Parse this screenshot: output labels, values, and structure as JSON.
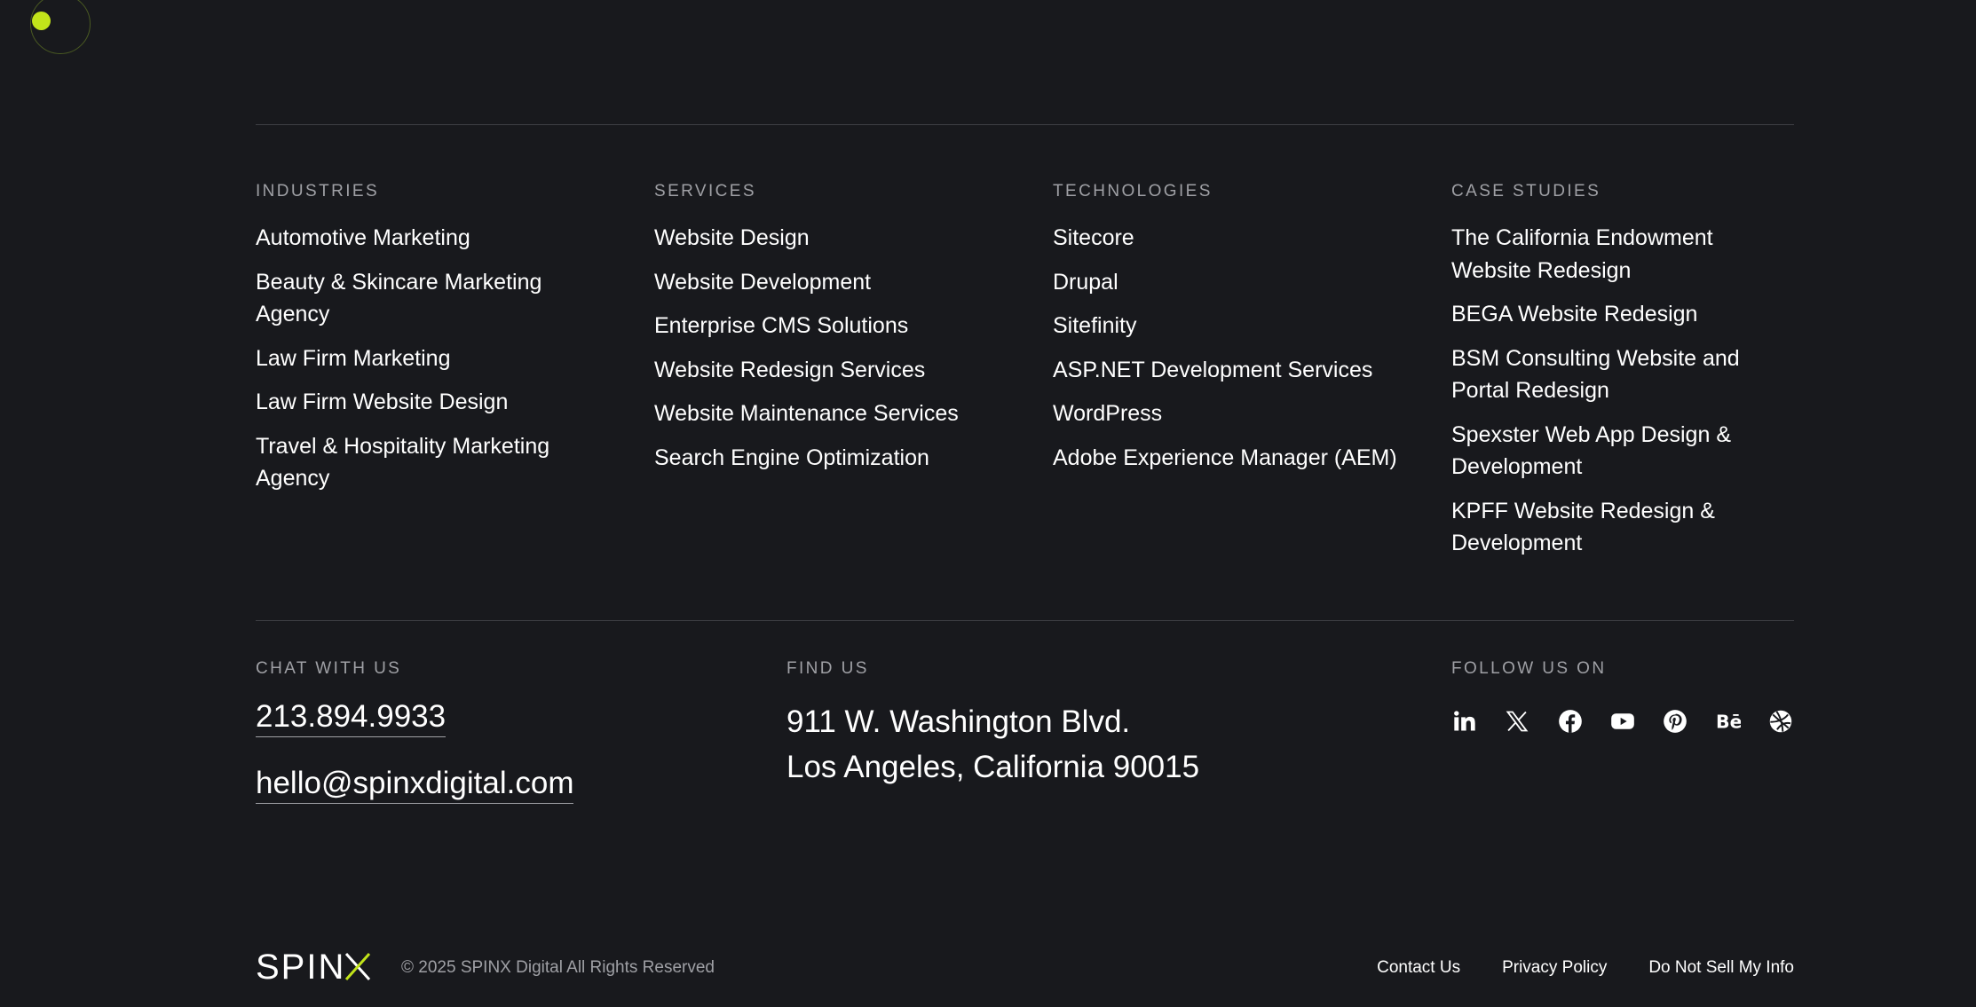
{
  "columns": [
    {
      "heading": "Industries",
      "links": [
        "Automotive Marketing",
        "Beauty & Skincare Marketing Agency",
        "Law Firm Marketing",
        "Law Firm Website Design",
        "Travel & Hospitality Marketing Agency"
      ]
    },
    {
      "heading": "Services",
      "links": [
        "Website Design",
        "Website Development",
        "Enterprise CMS Solutions",
        "Website Redesign Services",
        "Website Maintenance Services",
        "Search Engine Optimization"
      ]
    },
    {
      "heading": "Technologies",
      "links": [
        "Sitecore",
        "Drupal",
        "Sitefinity",
        "ASP.NET Development Services",
        "WordPress",
        "Adobe Experience Manager (AEM)"
      ]
    },
    {
      "heading": "Case Studies",
      "links": [
        "The California Endowment Website Redesign",
        "BEGA Website Redesign",
        "BSM Consulting Website and Portal Redesign",
        "Spexster Web App Design & Development",
        "KPFF Website Redesign & Development"
      ]
    }
  ],
  "chat": {
    "heading": "Chat with us",
    "phone": "213.894.9933",
    "email": "hello@spinxdigital.com"
  },
  "find": {
    "heading": "Find us",
    "address_line1": "911 W. Washington Blvd.",
    "address_line2": "Los Angeles, California 90015"
  },
  "follow": {
    "heading": "Follow us on",
    "icons": [
      "linkedin-icon",
      "x-twitter-icon",
      "facebook-icon",
      "youtube-icon",
      "pinterest-icon",
      "behance-icon",
      "dribbble-icon"
    ]
  },
  "bottom": {
    "logo_text": "SPINX",
    "copyright": "© 2025 SPINX Digital All Rights Reserved",
    "links": [
      "Contact Us",
      "Privacy Policy",
      "Do Not Sell My Info"
    ]
  },
  "colors": {
    "background": "#18191d",
    "accent": "#c2e41a",
    "muted_text": "#9fa0a5",
    "divider": "#3e3f44"
  }
}
